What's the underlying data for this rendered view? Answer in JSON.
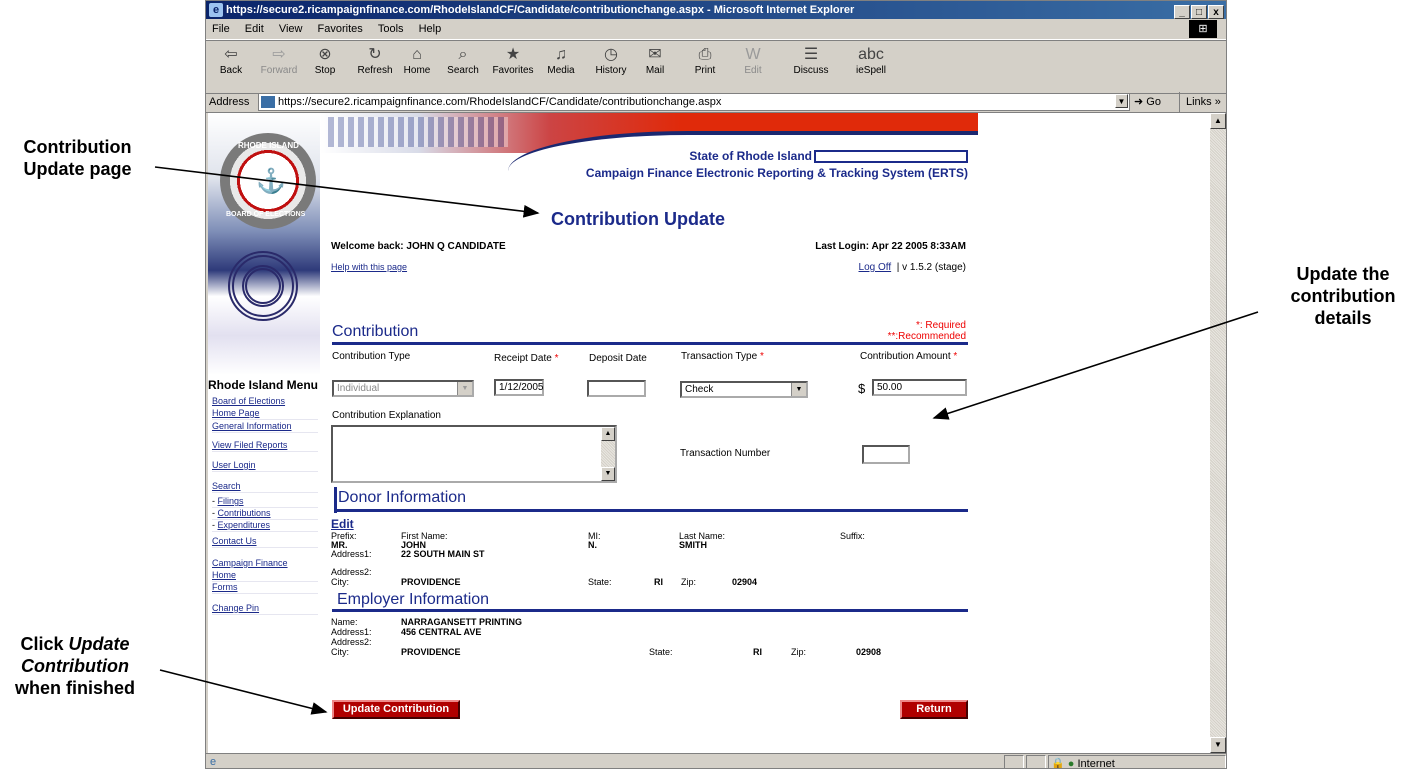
{
  "callouts": {
    "left_top": [
      "Contribution",
      "Update page"
    ],
    "right": [
      "Update the",
      "contribution",
      "details"
    ],
    "left_bottom_pre": "Click ",
    "left_bottom_em1": "Update",
    "left_bottom_em2": "Contribution",
    "left_bottom_post": "when finished"
  },
  "browser": {
    "title": "https://secure2.ricampaignfinance.com/RhodeIslandCF/Candidate/contributionchange.aspx - Microsoft Internet Explorer",
    "window_buttons": [
      "_",
      "□",
      "x"
    ],
    "menu": [
      "File",
      "Edit",
      "View",
      "Favorites",
      "Tools",
      "Help"
    ],
    "toolbar": [
      {
        "label": "Back",
        "icon": "back-arrow-icon",
        "glyph": "⇦",
        "enabled": true
      },
      {
        "label": "Forward",
        "icon": "forward-arrow-icon",
        "glyph": "⇨",
        "enabled": false
      },
      {
        "label": "Stop",
        "icon": "stop-icon",
        "glyph": "⊗",
        "enabled": true
      },
      {
        "label": "Refresh",
        "icon": "refresh-icon",
        "glyph": "↻",
        "enabled": true
      },
      {
        "label": "Home",
        "icon": "home-icon",
        "glyph": "⌂",
        "enabled": true
      },
      {
        "label": "Search",
        "icon": "search-icon",
        "glyph": "⌕",
        "enabled": true
      },
      {
        "label": "Favorites",
        "icon": "favorites-icon",
        "glyph": "★",
        "enabled": true
      },
      {
        "label": "Media",
        "icon": "media-icon",
        "glyph": "♫",
        "enabled": true
      },
      {
        "label": "History",
        "icon": "history-icon",
        "glyph": "◷",
        "enabled": true
      },
      {
        "label": "Mail",
        "icon": "mail-icon",
        "glyph": "✉",
        "enabled": true
      },
      {
        "label": "Print",
        "icon": "print-icon",
        "glyph": "⎙",
        "enabled": true
      },
      {
        "label": "Edit",
        "icon": "edit-icon",
        "glyph": "W",
        "enabled": false
      },
      {
        "label": "Discuss",
        "icon": "discuss-icon",
        "glyph": "☰",
        "enabled": true
      },
      {
        "label": "ieSpell",
        "icon": "iespell-icon",
        "glyph": "abc",
        "enabled": true
      }
    ],
    "address_label": "Address",
    "address_url": "https://secure2.ricampaignfinance.com/RhodeIslandCF/Candidate/contributionchange.aspx",
    "go_label": "Go",
    "links_label": "Links",
    "status_zone": "Internet"
  },
  "page": {
    "state_label": "State of Rhode Island",
    "system_title": "Campaign Finance Electronic Reporting & Tracking System (ERTS)",
    "seal_top": "RHODE ISLAND",
    "seal_bottom": "BOARD OF ELECTIONS",
    "page_title": "Contribution Update",
    "welcome": "Welcome back: JOHN Q CANDIDATE",
    "last_login": "Last Login: Apr 22 2005 8:33AM",
    "help_link": "Help with this page",
    "logoff": "Log Off",
    "version": "| v 1.5.2 (stage)",
    "contribution": {
      "heading": "Contribution",
      "required_note": "*: Required",
      "recommended_note": "**:Recommended",
      "type_label": "Contribution Type",
      "type_value": "Individual",
      "receipt_label": "Receipt Date",
      "receipt_value": "1/12/2005",
      "deposit_label": "Deposit Date",
      "deposit_value": "",
      "transaction_type_label": "Transaction Type",
      "transaction_type_value": "Check",
      "amount_label": "Contribution Amount",
      "amount_currency": "$",
      "amount_value": "50.00",
      "explanation_label": "Contribution Explanation",
      "transaction_number_label": "Transaction Number",
      "transaction_number_value": "",
      "required_mark": "*"
    },
    "donor": {
      "heading": "Donor Information",
      "edit": "Edit",
      "prefix_label": "Prefix:",
      "prefix": "MR.",
      "first_label": "First Name:",
      "first": "JOHN",
      "mi_label": "MI:",
      "mi": "N.",
      "last_label": "Last Name:",
      "last": "SMITH",
      "suffix_label": "Suffix:",
      "address1_label": "Address1:",
      "address1": "22 SOUTH MAIN ST",
      "address2_label": "Address2:",
      "city_label": "City:",
      "city": "PROVIDENCE",
      "state_label": "State:",
      "state": "RI",
      "zip_label": "Zip:",
      "zip": "02904"
    },
    "employer": {
      "heading": "Employer Information",
      "name_label": "Name:",
      "name": "NARRAGANSETT PRINTING",
      "address1_label": "Address1:",
      "address1": "456 CENTRAL AVE",
      "address2_label": "Address2:",
      "city_label": "City:",
      "city": "PROVIDENCE",
      "state_label": "State:",
      "state": "RI",
      "zip_label": "Zip:",
      "zip": "02908"
    },
    "update_button": "Update Contribution",
    "return_button": "Return"
  },
  "sidebar": {
    "title": "Rhode Island Menu",
    "items": [
      {
        "line1": "Board of Elections",
        "line2": "Home Page"
      },
      {
        "line1": "General Information"
      },
      {
        "line1": "View Filed Reports"
      },
      {
        "line1": "User Login"
      },
      {
        "line1": "Search"
      },
      {
        "line1": "- ",
        "link": "Filings"
      },
      {
        "line1": "- ",
        "link": "Contributions"
      },
      {
        "line1": "- ",
        "link": "Expenditures"
      },
      {
        "line1": "Contact Us"
      },
      {
        "line1": "Campaign Finance",
        "line2": "Home"
      },
      {
        "line1": "Forms"
      },
      {
        "line1": "Change Pin"
      }
    ]
  }
}
